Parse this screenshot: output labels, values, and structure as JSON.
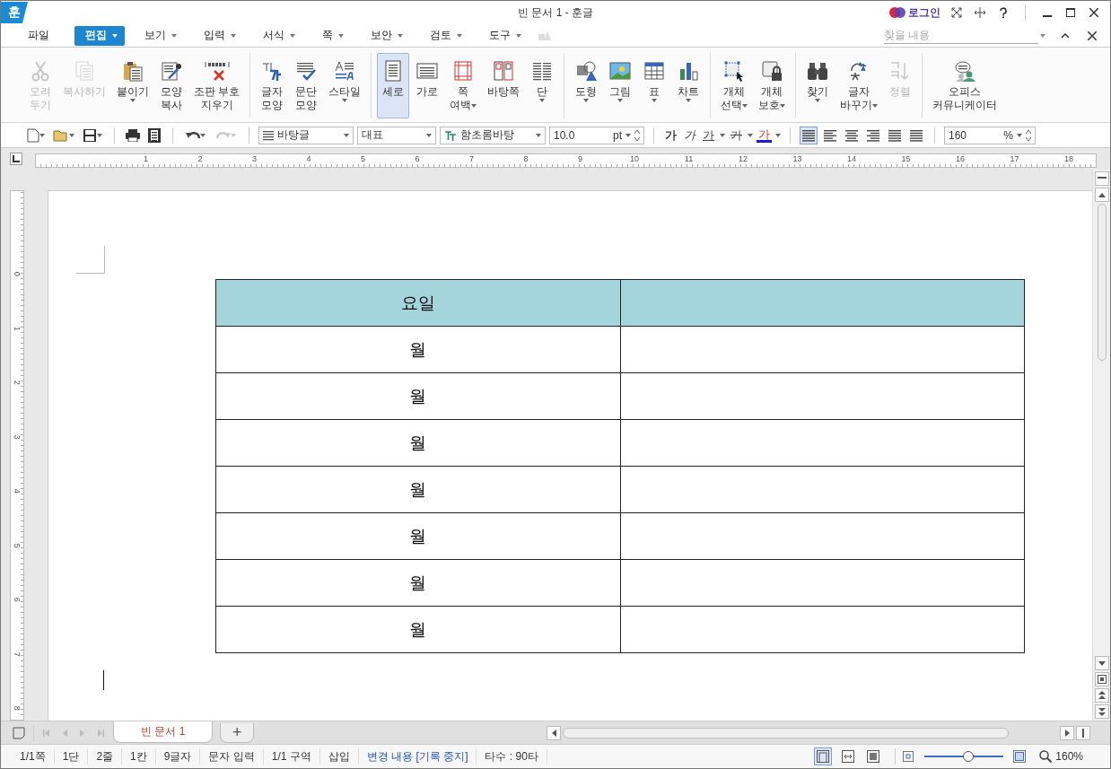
{
  "window": {
    "logo": "훈",
    "title": "빈 문서 1 - 훈글",
    "login": "로그인"
  },
  "menu": [
    {
      "label": "파일",
      "selected": false,
      "dropdown": false
    },
    {
      "label": "편집",
      "selected": true,
      "dropdown": true
    },
    {
      "label": "보기",
      "selected": false,
      "dropdown": true
    },
    {
      "label": "입력",
      "selected": false,
      "dropdown": true
    },
    {
      "label": "서식",
      "selected": false,
      "dropdown": true
    },
    {
      "label": "쪽",
      "selected": false,
      "dropdown": true
    },
    {
      "label": "보안",
      "selected": false,
      "dropdown": true
    },
    {
      "label": "검토",
      "selected": false,
      "dropdown": true
    },
    {
      "label": "도구",
      "selected": false,
      "dropdown": true
    }
  ],
  "search": {
    "placeholder": "찾을 내용"
  },
  "ribbon": [
    [
      {
        "lines": [
          "오려",
          "두기"
        ],
        "disabled": true,
        "selected": false,
        "dropdown": false
      },
      {
        "lines": [
          "복사하기"
        ],
        "disabled": true,
        "selected": false,
        "dropdown": false
      },
      {
        "lines": [
          "붙이기"
        ],
        "disabled": false,
        "selected": false,
        "dropdown": true
      },
      {
        "lines": [
          "모양",
          "복사"
        ],
        "disabled": false,
        "selected": false,
        "dropdown": false
      },
      {
        "lines": [
          "조판 부호",
          "지우기"
        ],
        "disabled": false,
        "selected": false,
        "dropdown": false
      }
    ],
    [
      {
        "lines": [
          "글자",
          "모양"
        ],
        "disabled": false,
        "selected": false,
        "dropdown": false
      },
      {
        "lines": [
          "문단",
          "모양"
        ],
        "disabled": false,
        "selected": false,
        "dropdown": false
      },
      {
        "lines": [
          "스타일"
        ],
        "disabled": false,
        "selected": false,
        "dropdown": true
      }
    ],
    [
      {
        "lines": [
          "세로"
        ],
        "disabled": false,
        "selected": true,
        "dropdown": false
      },
      {
        "lines": [
          "가로"
        ],
        "disabled": false,
        "selected": false,
        "dropdown": false
      },
      {
        "lines": [
          "쪽",
          "여백"
        ],
        "disabled": false,
        "selected": false,
        "dropdown": true
      },
      {
        "lines": [
          "바탕쪽"
        ],
        "disabled": false,
        "selected": false,
        "dropdown": false
      },
      {
        "lines": [
          "단"
        ],
        "disabled": false,
        "selected": false,
        "dropdown": true
      }
    ],
    [
      {
        "lines": [
          "도형"
        ],
        "disabled": false,
        "selected": false,
        "dropdown": true
      },
      {
        "lines": [
          "그림"
        ],
        "disabled": false,
        "selected": false,
        "dropdown": true
      },
      {
        "lines": [
          "표"
        ],
        "disabled": false,
        "selected": false,
        "dropdown": true
      },
      {
        "lines": [
          "차트"
        ],
        "disabled": false,
        "selected": false,
        "dropdown": true
      }
    ],
    [
      {
        "lines": [
          "개체",
          "선택"
        ],
        "disabled": false,
        "selected": false,
        "dropdown": true
      },
      {
        "lines": [
          "개체",
          "보호"
        ],
        "disabled": false,
        "selected": false,
        "dropdown": true
      }
    ],
    [
      {
        "lines": [
          "찾기"
        ],
        "disabled": false,
        "selected": false,
        "dropdown": true
      },
      {
        "lines": [
          "글자",
          "바꾸기"
        ],
        "disabled": false,
        "selected": false,
        "dropdown": true
      },
      {
        "lines": [
          "정렬"
        ],
        "disabled": true,
        "selected": false,
        "dropdown": false
      }
    ],
    [
      {
        "lines": [
          "오피스",
          "커뮤니케이터"
        ],
        "disabled": false,
        "selected": false,
        "dropdown": false
      }
    ]
  ],
  "toolbar": {
    "style": "바탕글",
    "outline": "대표",
    "font": "함초롬바탕",
    "size": "10.0",
    "size_unit": "pt",
    "zoom": "160",
    "zoom_unit": "%",
    "char_buttons": [
      {
        "label": "가",
        "kind": "bold"
      },
      {
        "label": "가",
        "kind": "italic"
      },
      {
        "label": "가",
        "kind": "underline"
      },
      {
        "label": "가",
        "kind": "strike"
      },
      {
        "label": "가",
        "kind": "color"
      }
    ],
    "align": [
      {
        "selected": true
      },
      {
        "selected": false
      },
      {
        "selected": false
      },
      {
        "selected": false
      },
      {
        "selected": false
      },
      {
        "selected": false
      }
    ]
  },
  "ruler": {
    "marks": [
      "1",
      "2",
      "3",
      "4",
      "5",
      "6",
      "7",
      "8",
      "9",
      "10",
      "11",
      "12",
      "13",
      "14",
      "15",
      "16",
      "17",
      "18"
    ],
    "vertical_marks": [
      "0",
      "1",
      "2",
      "3",
      "4",
      "5",
      "6",
      "7",
      "8"
    ]
  },
  "table": {
    "header": "요일",
    "rows": [
      "월",
      "월",
      "월",
      "월",
      "월",
      "월",
      "월"
    ]
  },
  "doc_tabs": [
    {
      "label": "빈 문서 1",
      "selected": true
    }
  ],
  "add_tab": "+",
  "status_bar": [
    {
      "text": "1/1쪽",
      "kind": "info"
    },
    {
      "text": "1단",
      "kind": "info"
    },
    {
      "text": "2줄",
      "kind": "info"
    },
    {
      "text": "1칸",
      "kind": "info"
    },
    {
      "text": "9글자",
      "kind": "info"
    },
    {
      "text": "문자 입력",
      "kind": "info"
    },
    {
      "text": "1/1 구역",
      "kind": "info"
    },
    {
      "text": "삽입",
      "kind": "info"
    },
    {
      "text": "변경 내용 [기록 중지]",
      "kind": "tracking"
    },
    {
      "text": "타수 : 90타",
      "kind": "info"
    }
  ],
  "view_modes": [
    {
      "selected": true
    },
    {
      "selected": false
    },
    {
      "selected": false
    }
  ],
  "zoom_slider": {
    "level": 0.55,
    "reading": "160%"
  }
}
